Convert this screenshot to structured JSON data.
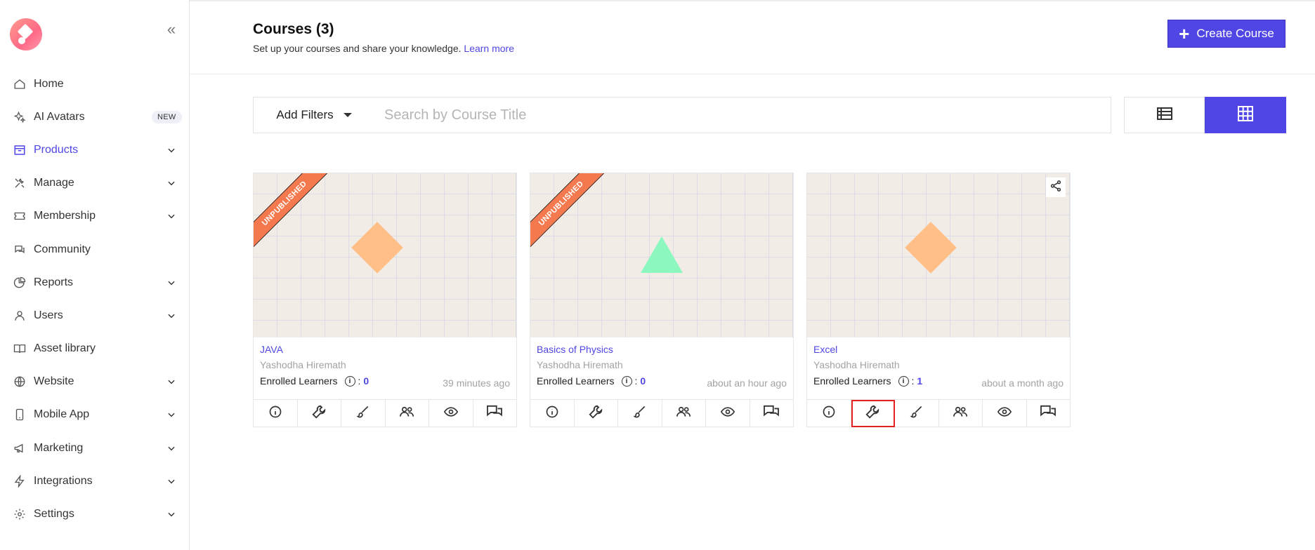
{
  "sidebar": {
    "items": [
      {
        "label": "Home",
        "icon": "home-icon",
        "chevron": false
      },
      {
        "label": "AI Avatars",
        "icon": "sparkle-icon",
        "badge": "NEW",
        "chevron": false
      },
      {
        "label": "Products",
        "icon": "box-icon",
        "chevron": true,
        "active": true
      },
      {
        "label": "Manage",
        "icon": "tools-icon",
        "chevron": true
      },
      {
        "label": "Membership",
        "icon": "ticket-icon",
        "chevron": true
      },
      {
        "label": "Community",
        "icon": "chat-icon",
        "chevron": false
      },
      {
        "label": "Reports",
        "icon": "pie-chart-icon",
        "chevron": true
      },
      {
        "label": "Users",
        "icon": "user-icon",
        "chevron": true
      },
      {
        "label": "Asset library",
        "icon": "book-icon",
        "chevron": false
      },
      {
        "label": "Website",
        "icon": "globe-icon",
        "chevron": true
      },
      {
        "label": "Mobile App",
        "icon": "mobile-icon",
        "chevron": true
      },
      {
        "label": "Marketing",
        "icon": "megaphone-icon",
        "chevron": true
      },
      {
        "label": "Integrations",
        "icon": "bolt-icon",
        "chevron": true
      },
      {
        "label": "Settings",
        "icon": "gear-icon",
        "chevron": true
      }
    ]
  },
  "header": {
    "title": "Courses (3)",
    "subtitle": "Set up your courses and share your knowledge.",
    "learn_more": "Learn more",
    "create_button": "Create Course"
  },
  "toolbar": {
    "filters_label": "Add Filters",
    "search_placeholder": "Search by Course Title"
  },
  "cards": [
    {
      "title": "JAVA",
      "author": "Yashodha Hiremath",
      "enrolled_label": "Enrolled Learners",
      "enrolled_count": "0",
      "time": "39 minutes ago",
      "ribbon": "UNPUBLISHED",
      "shape": "diamond",
      "shape_color": "#ffbf86"
    },
    {
      "title": "Basics of Physics",
      "author": "Yashodha Hiremath",
      "enrolled_label": "Enrolled Learners",
      "enrolled_count": "0",
      "time": "about an hour ago",
      "ribbon": "UNPUBLISHED",
      "shape": "triangle",
      "shape_color": "#8cf7bf"
    },
    {
      "title": "Excel",
      "author": "Yashodha Hiremath",
      "enrolled_label": "Enrolled Learners",
      "enrolled_count": "1",
      "time": "about a month ago",
      "ribbon": "",
      "shape": "diamond",
      "shape_color": "#ffbf86"
    }
  ],
  "colors": {
    "accent": "#4f46e5",
    "ribbon": "#f4794f",
    "highlight": "#e52222"
  }
}
